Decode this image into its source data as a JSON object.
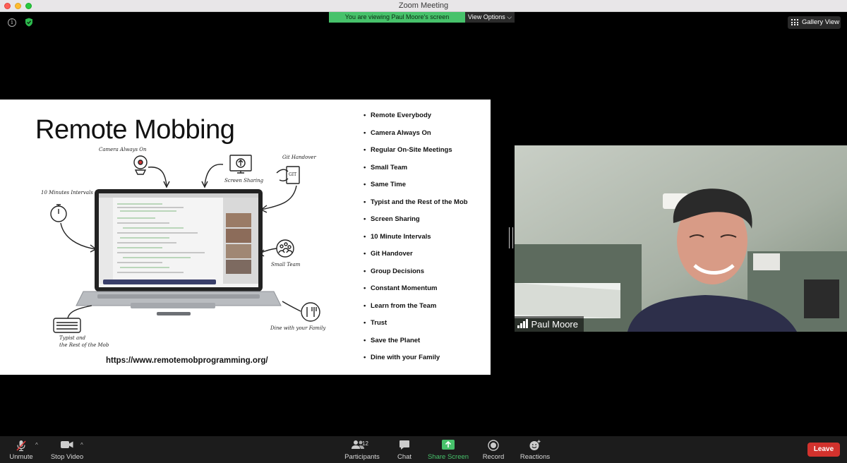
{
  "window": {
    "title": "Zoom Meeting"
  },
  "banner": {
    "viewing_text": "You are viewing Paul Moore's screen",
    "view_options_label": "View Options ⌵"
  },
  "gallery_view_label": "Gallery View",
  "slide": {
    "title": "Remote Mobbing",
    "url": "https://www.remotemobprogramming.org/",
    "bullets": [
      "Remote Everybody",
      "Camera Always On",
      "Regular On-Site Meetings",
      "Small Team",
      "Same Time",
      "Typist and the Rest of the Mob",
      "Screen Sharing",
      "10 Minute Intervals",
      "Git Handover",
      "Group Decisions",
      "Constant Momentum",
      "Learn from the Team",
      "Trust",
      "Save the Planet",
      "Dine with your Family"
    ],
    "sketch_labels": {
      "camera": "Camera Always On",
      "screen": "Screen Sharing",
      "git": "Git Handover",
      "git_icon_text": "GIT",
      "intervals": "10 Minutes Intervals",
      "team": "Small Team",
      "typist_1": "Typist and",
      "typist_2": "the Rest of the Mob",
      "dine": "Dine with your Family"
    }
  },
  "participant": {
    "name": "Paul Moore"
  },
  "toolbar": {
    "unmute": "Unmute",
    "stop_video": "Stop Video",
    "participants": "Participants",
    "participants_count": "12",
    "chat": "Chat",
    "share_screen": "Share Screen",
    "record": "Record",
    "reactions": "Reactions",
    "leave": "Leave"
  },
  "colors": {
    "banner_green": "#47c26b",
    "leave_red": "#d2322d",
    "share_green": "#47c26b",
    "toolbar_bg": "#1c1c1c"
  }
}
